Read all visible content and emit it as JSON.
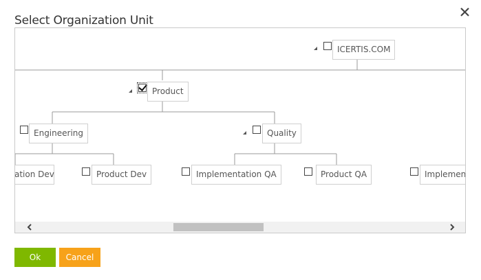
{
  "dialog": {
    "title": "Select Organization Unit",
    "close_icon": "close-icon"
  },
  "tree": {
    "root": {
      "label": "ICERTIS.COM",
      "checked": false,
      "expanded": true
    },
    "product": {
      "label": "Product",
      "checked": true,
      "expanded": true
    },
    "engineering": {
      "label": "Engineering",
      "checked": false
    },
    "quality": {
      "label": "Quality",
      "checked": false,
      "expanded": true
    },
    "implementation_dev": {
      "label": "ation Dev",
      "checked": false
    },
    "product_dev": {
      "label": "Product Dev",
      "checked": false
    },
    "implementation_qa": {
      "label": "Implementation QA",
      "checked": false
    },
    "product_qa": {
      "label": "Product QA",
      "checked": false
    },
    "implementation_more": {
      "label": "Implement",
      "checked": false
    }
  },
  "scrollbar": {
    "left_icon": "chevron-left-icon",
    "right_icon": "chevron-right-icon"
  },
  "buttons": {
    "ok_label": "Ok",
    "cancel_label": "Cancel"
  },
  "colors": {
    "ok": "#7fb800",
    "cancel": "#f7a21a",
    "node_border": "#cfcfcf",
    "connector": "#999999"
  }
}
